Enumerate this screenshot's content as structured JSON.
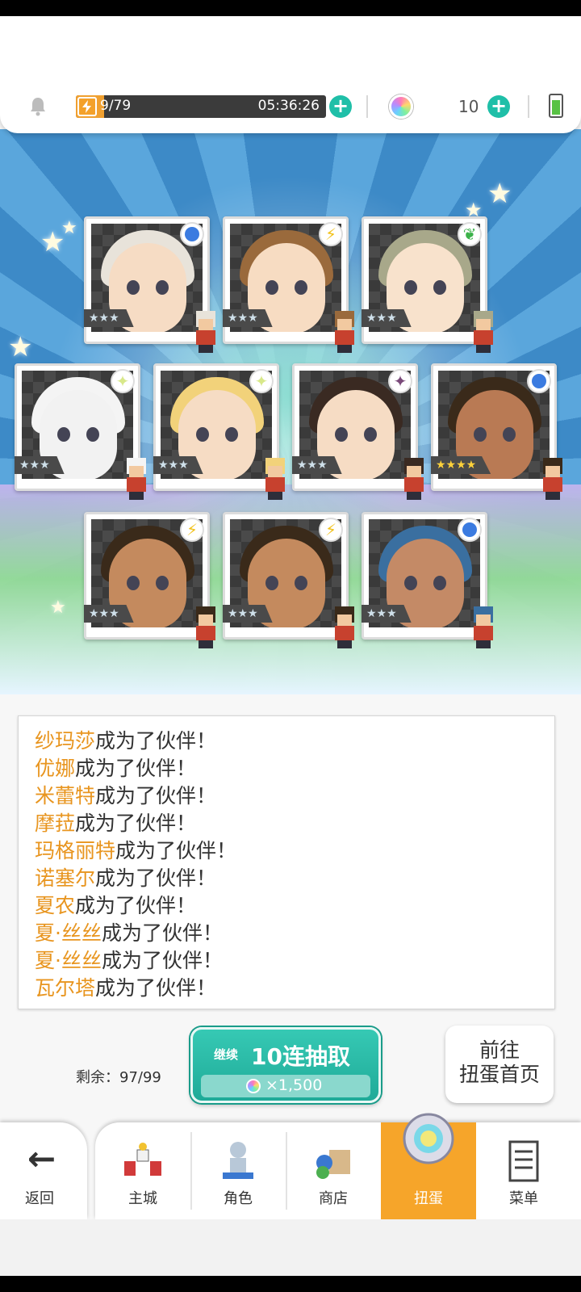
{
  "header": {
    "stamina": "9/79",
    "stamina_level": 0.114,
    "stamina_timer": "05:36:26",
    "gem_count": "10"
  },
  "cards": [
    {
      "element": "water",
      "stars": "★★★",
      "rarity": 3,
      "hair": "#e8e3da",
      "skin": "#f6dcc4"
    },
    {
      "element": "bolt",
      "stars": "★★★",
      "rarity": 3,
      "hair": "#9a6a3c",
      "skin": "#f7dcc2"
    },
    {
      "element": "leaf",
      "stars": "★★★",
      "rarity": 3,
      "hair": "#a8a88a",
      "skin": "#f8e2cc"
    },
    {
      "element": "light",
      "stars": "★★★",
      "rarity": 3,
      "hair": "#f4f4f4",
      "skin": "#f2f2f2"
    },
    {
      "element": "light",
      "stars": "★★★",
      "rarity": 3,
      "hair": "#f2d27a",
      "skin": "#f6dcc4"
    },
    {
      "element": "dark",
      "stars": "★★★",
      "rarity": 3,
      "hair": "#3a2a22",
      "skin": "#f6dcc4"
    },
    {
      "element": "water",
      "stars": "★★★★",
      "rarity": 4,
      "hair": "#3a2a1a",
      "skin": "#b97a54"
    },
    {
      "element": "bolt",
      "stars": "★★★",
      "rarity": 3,
      "hair": "#3a2a1a",
      "skin": "#c48a5e"
    },
    {
      "element": "bolt",
      "stars": "★★★",
      "rarity": 3,
      "hair": "#3a2a1a",
      "skin": "#c48a5e"
    },
    {
      "element": "water",
      "stars": "★★★",
      "rarity": 3,
      "hair": "#3a6fa0",
      "skin": "#c48a66"
    }
  ],
  "log": [
    {
      "name": "纱玛莎",
      "suffix": "成为了伙伴！"
    },
    {
      "name": "优娜",
      "suffix": "成为了伙伴！"
    },
    {
      "name": "米蕾特",
      "suffix": "成为了伙伴！"
    },
    {
      "name": "摩菈",
      "suffix": "成为了伙伴！"
    },
    {
      "name": "玛格丽特",
      "suffix": "成为了伙伴！"
    },
    {
      "name": "诺塞尔",
      "suffix": "成为了伙伴！"
    },
    {
      "name": "夏农",
      "suffix": "成为了伙伴！"
    },
    {
      "name": "夏·丝丝",
      "suffix": "成为了伙伴！"
    },
    {
      "name": "夏·丝丝",
      "suffix": "成为了伙伴！"
    },
    {
      "name": "瓦尔塔",
      "suffix": "成为了伙伴！"
    }
  ],
  "actions": {
    "remaining": "剩余：97/99",
    "draw_small": "继续",
    "draw_main": "10连抽取",
    "draw_cost": "×1,500",
    "home_line1": "前往",
    "home_line2": "扭蛋首页"
  },
  "nav": {
    "back": "返回",
    "items": [
      "主城",
      "角色",
      "商店",
      "扭蛋",
      "菜单"
    ],
    "active_index": 3
  },
  "colors": {
    "accent": "#1fbfa8",
    "nav_active": "#f6a52a",
    "name_highlight": "#e8951f"
  }
}
